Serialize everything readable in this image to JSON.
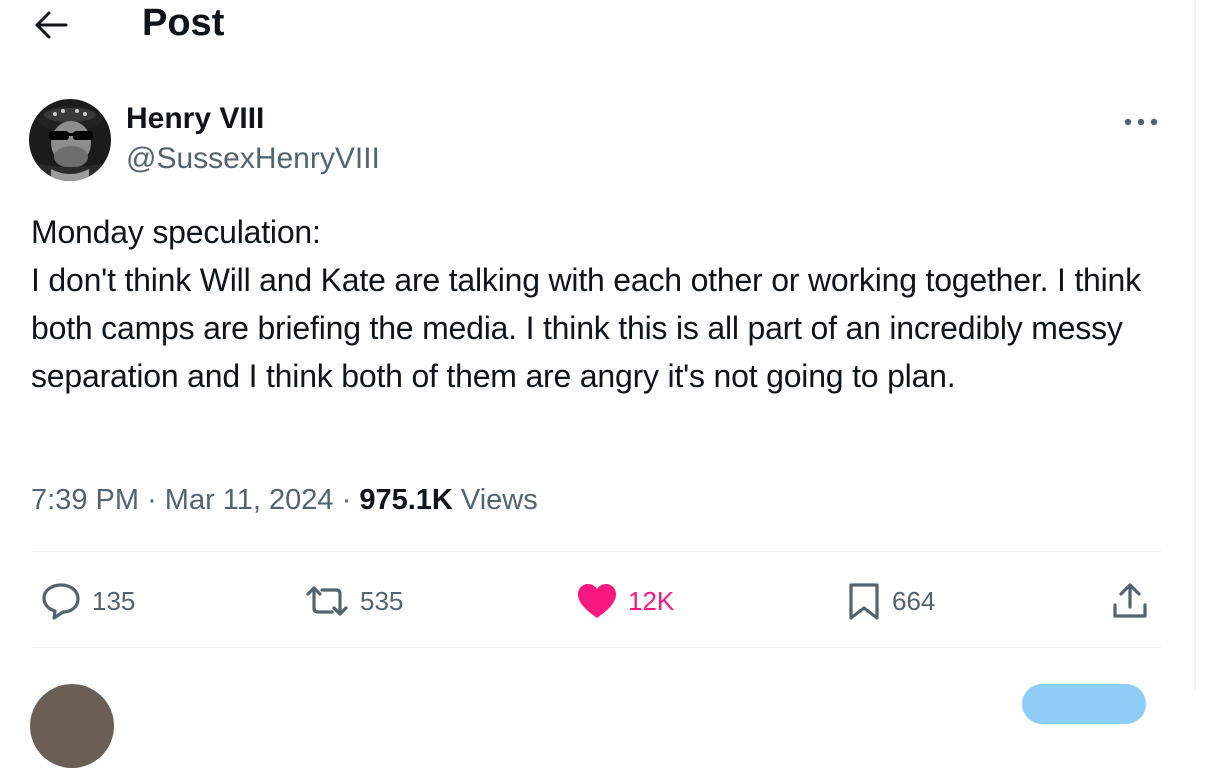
{
  "header": {
    "back_icon": "arrow-left-icon",
    "title": "Post"
  },
  "author": {
    "name": "Henry VIII",
    "handle": "@SussexHenryVIII",
    "avatar": "henry-viii-portrait-with-sunglasses"
  },
  "more_icon": "ellipsis-icon",
  "tweet": {
    "text": "Monday speculation:\nI don't think Will and Kate are talking with each other or working together. I think both camps are briefing the media. I think this is all part of an incredibly messy separation and I think both of them are angry it's not going to plan."
  },
  "meta": {
    "time": "7:39 PM",
    "separator": "·",
    "date": "Mar 11, 2024",
    "views_count": "975.1K",
    "views_label": "Views"
  },
  "actions": {
    "reply": {
      "icon": "reply-icon",
      "count": "135"
    },
    "repost": {
      "icon": "repost-icon",
      "count": "535"
    },
    "like": {
      "icon": "heart-icon",
      "count": "12K",
      "color": "#f91880",
      "liked": true
    },
    "bookmark": {
      "icon": "bookmark-icon",
      "count": "664"
    },
    "share": {
      "icon": "share-icon"
    }
  },
  "colors": {
    "text_primary": "#0f1419",
    "text_secondary": "#536471",
    "like_pink": "#f91880",
    "divider": "#eff3f4"
  }
}
